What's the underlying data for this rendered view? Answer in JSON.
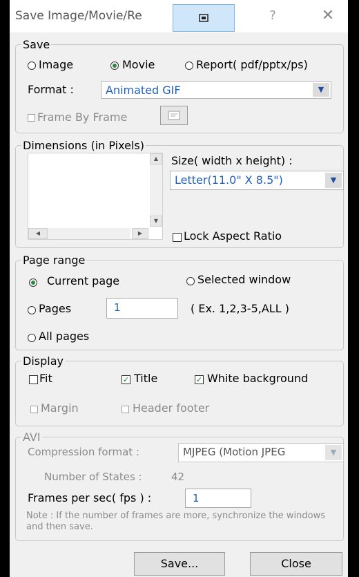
{
  "window": {
    "title": "Save Image/Movie/Re",
    "help_label": "?",
    "close_glyph": "✕",
    "restore_glyph": "⊟"
  },
  "save": {
    "legend": "Save",
    "options": [
      "Image",
      "Movie",
      "Report( pdf/pptx/ps)"
    ],
    "selected": "Movie",
    "format_label": "Format :",
    "format_value": "Animated GIF",
    "frame_by_frame_label": "Frame By Frame"
  },
  "dimensions": {
    "legend": "Dimensions (in Pixels)",
    "size_label": "Size( width x height) :",
    "size_value": "Letter(11.0\" X 8.5\")",
    "lock_aspect_label": "Lock Aspect Ratio"
  },
  "page_range": {
    "legend": "Page range",
    "current_page_label": "Current page",
    "selected_window_label": "Selected window",
    "pages_label": "Pages",
    "pages_value": "1",
    "pages_hint": "( Ex. 1,2,3-5,ALL )",
    "all_pages_label": "All pages"
  },
  "display": {
    "legend": "Display",
    "fit_label": "Fit",
    "title_label": "Title",
    "white_bg_label": "White background",
    "margin_label": "Margin",
    "header_footer_label": "Header footer"
  },
  "avi": {
    "legend": "AVI",
    "compression_label": "Compression format :",
    "compression_value": "MJPEG (Motion JPEG",
    "states_label": "Number of States :",
    "states_value": "42",
    "fps_label": "Frames per sec( fps ) :",
    "fps_value": "1",
    "note": "Note : If the number of frames are more, synchronize the windows and then save."
  },
  "buttons": {
    "save": "Save...",
    "close": "Close"
  }
}
